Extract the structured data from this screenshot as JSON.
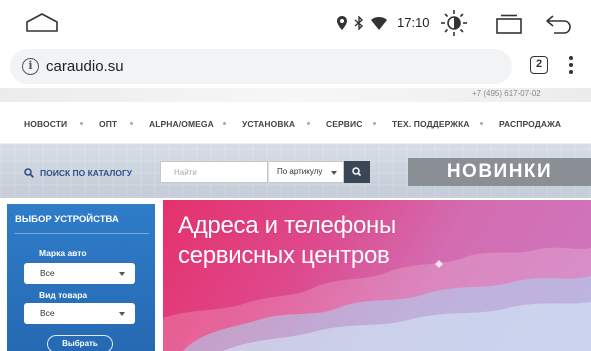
{
  "statusbar": {
    "time": "17:10",
    "icons": [
      "location-icon",
      "bluetooth-icon",
      "wifi-icon"
    ]
  },
  "browser": {
    "url": "caraudio.su",
    "tab_count": "2"
  },
  "site": {
    "phone": "+7 (495) 617-07-02",
    "nav": [
      "НОВОСТИ",
      "ОПТ",
      "ALPHA/OMEGA",
      "УСТАНОВКА",
      "СЕРВИС",
      "ТЕХ. ПОДДЕРЖКА",
      "РАСПРОДАЖА"
    ],
    "search": {
      "label": "ПОИСК ПО КАТАЛОГУ",
      "placeholder": "Найти",
      "mode": "По артикулу"
    },
    "novinki": "НОВИНКИ",
    "device_picker": {
      "title": "ВЫБОР УСТРОЙСТВА",
      "brand_label": "Марка авто",
      "brand_value": "Все",
      "type_label": "Вид товара",
      "type_value": "Все",
      "submit": "Выбрать"
    },
    "banner": {
      "line1": "Адреса и телефоны",
      "line2": "сервисных центров"
    }
  },
  "colors": {
    "sidebar_blue": "#2c74c1",
    "banner_pink": "#e0407f",
    "novinki_gray": "#8a8f96",
    "search_button": "#3a4556"
  }
}
